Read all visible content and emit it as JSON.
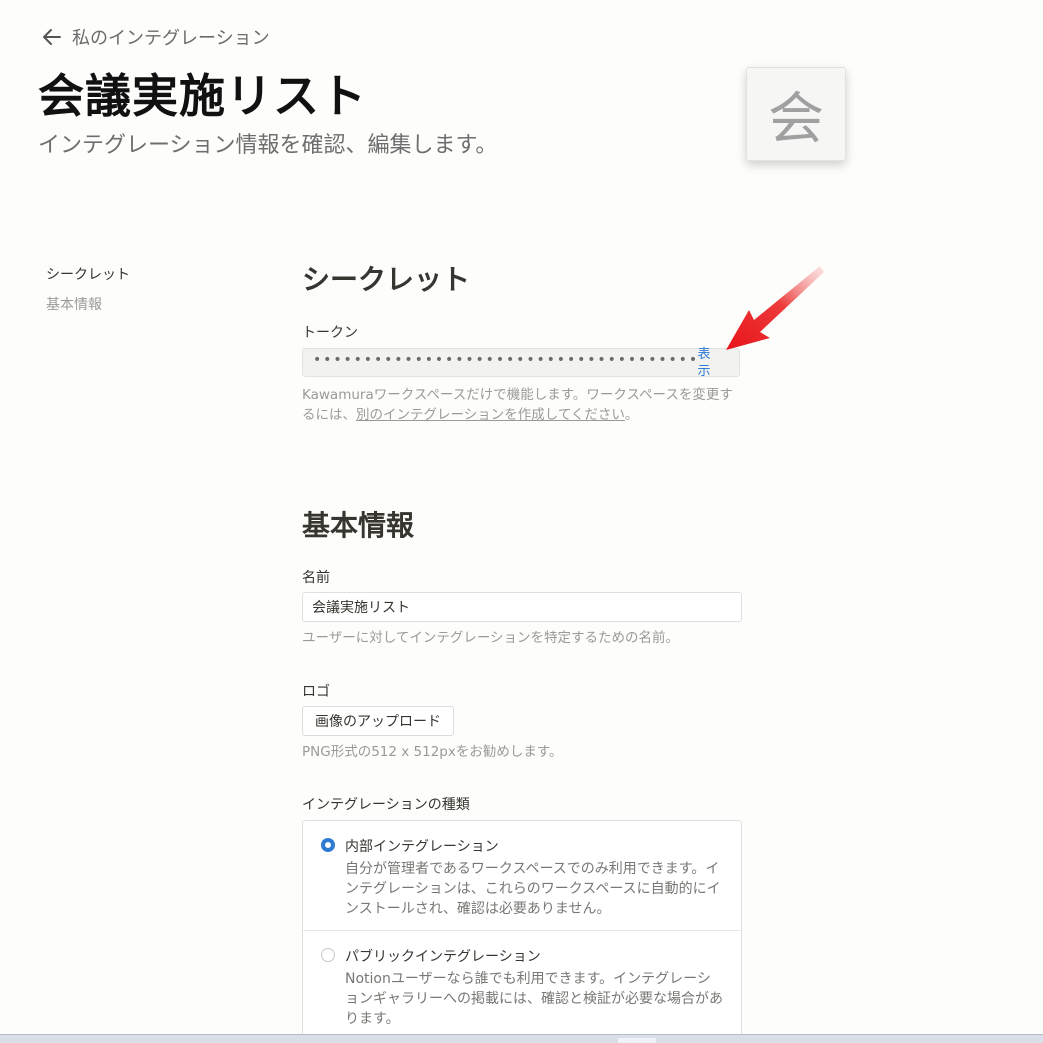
{
  "header": {
    "back_label": "私のインテグレーション",
    "title": "会議実施リスト",
    "subtitle": "インテグレーション情報を確認、編集します。",
    "logo_char": "会"
  },
  "sidebar": {
    "items": [
      {
        "label": "シークレット",
        "active": true
      },
      {
        "label": "基本情報",
        "active": false
      }
    ]
  },
  "secret": {
    "heading": "シークレット",
    "token_label": "トークン",
    "token_masked": "••••••••••••••••••••••••••••••••••••••",
    "show_label": "表示",
    "helper_before": "Kawamuraワークスペースだけで機能します。ワークスペースを変更するには、",
    "helper_link": "別のインテグレーションを作成してください",
    "helper_after": "。"
  },
  "basic": {
    "heading": "基本情報",
    "name_label": "名前",
    "name_value": "会議実施リスト",
    "name_helper": "ユーザーに対してインテグレーションを特定するための名前。",
    "logo_label": "ロゴ",
    "upload_label": "画像のアップロード",
    "logo_helper": "PNG形式の512 x 512pxをお勧めします。",
    "type_label": "インテグレーションの種類",
    "types": [
      {
        "title": "内部インテグレーション",
        "desc": "自分が管理者であるワークスペースでのみ利用できます。インテグレーションは、これらのワークスペースに自動的にインストールされ、確認は必要ありません。",
        "selected": true
      },
      {
        "title": "パブリックインテグレーション",
        "desc": "Notionユーザーなら誰でも利用できます。インテグレーションギャラリーへの掲載には、確認と検証が必要な場合があります。",
        "selected": false
      }
    ]
  },
  "colors": {
    "accent": "#2e7bd6",
    "annotation_arrow": "#e8141b"
  }
}
